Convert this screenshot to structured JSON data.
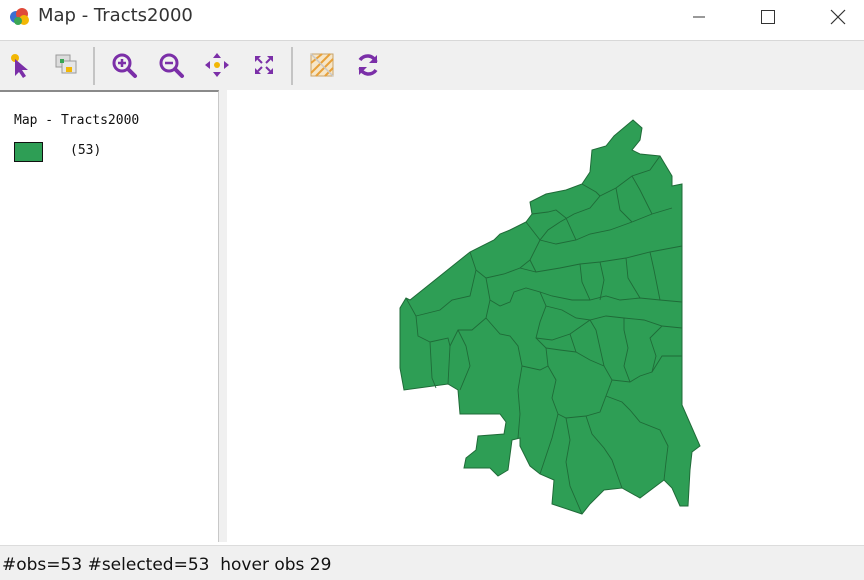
{
  "window": {
    "title": "Map - Tracts2000",
    "controls": [
      "minimize-icon",
      "maximize-icon",
      "close-icon"
    ]
  },
  "toolbar": {
    "buttons": [
      {
        "name": "select-arrow-icon"
      },
      {
        "name": "selection-tool-icon"
      },
      {
        "name": "zoom-in-icon"
      },
      {
        "name": "zoom-out-icon"
      },
      {
        "name": "pan-icon"
      },
      {
        "name": "full-extent-icon"
      },
      {
        "name": "basemap-icon"
      },
      {
        "name": "refresh-icon"
      }
    ]
  },
  "legend": {
    "title": "Map - Tracts2000",
    "items": [
      {
        "label": "(53)",
        "color": "#2e9e55"
      }
    ]
  },
  "map": {
    "fill_color": "#2e9e55",
    "stroke_color": "#1f6b38"
  },
  "status": {
    "text": "#obs=53 #selected=53  hover obs 29"
  },
  "colors": {
    "accent_purple": "#7b2fa8",
    "tract_green": "#2e9e55"
  }
}
